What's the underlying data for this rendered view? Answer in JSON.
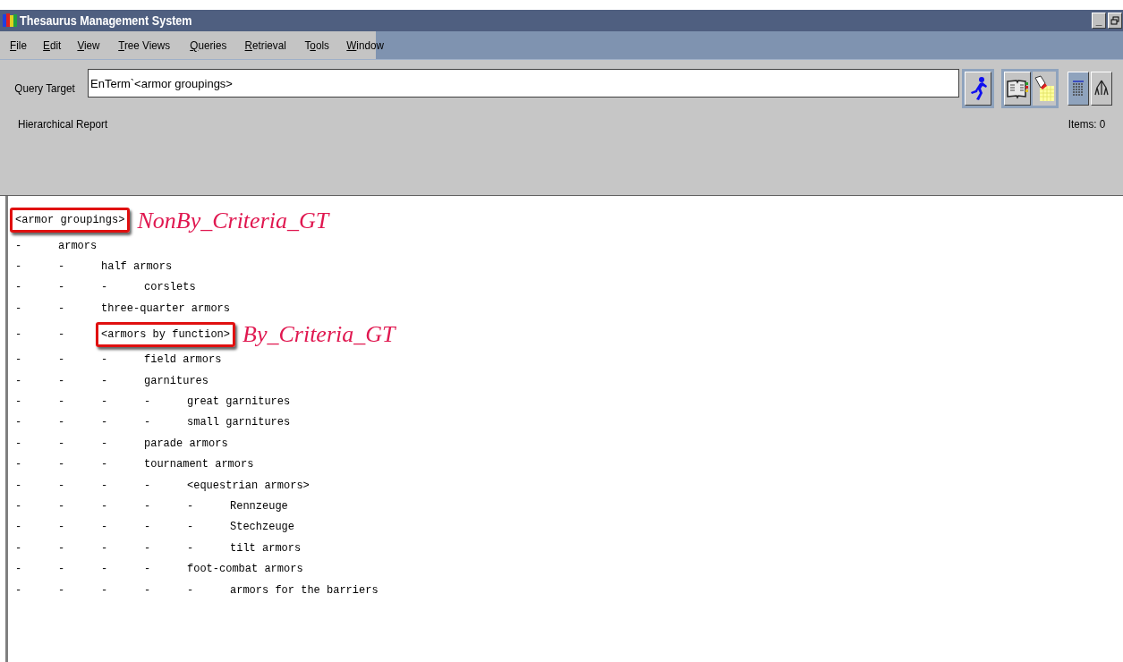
{
  "window": {
    "title": "Thesaurus Management System",
    "controls": [
      "_"
    ]
  },
  "menu": [
    {
      "key": "F",
      "post": "ile"
    },
    {
      "key": "E",
      "post": "dit"
    },
    {
      "key": "V",
      "post": "iew"
    },
    {
      "key": "T",
      "post": "ree Views"
    },
    {
      "key": "Q",
      "post": "ueries"
    },
    {
      "key": "R",
      "post": "etrieval"
    },
    {
      "pre": "T",
      "key": "o",
      "post": "ols"
    },
    {
      "key": "W",
      "post": "indow"
    }
  ],
  "query": {
    "label": "Query Target",
    "value": "EnTerm`<armor groupings>"
  },
  "report": {
    "title": "Hierarchical Report",
    "items": "Items: 0",
    "indent_mark": "-",
    "tree": [
      {
        "text": "<armor groupings>",
        "annotation": "NonBy_Criteria_GT",
        "children": [
          {
            "text": "armors",
            "children": [
              {
                "text": "half armors",
                "children": [
                  {
                    "text": "corslets"
                  }
                ]
              },
              {
                "text": "three-quarter armors"
              },
              {
                "text": "<armors by function>",
                "annotation": "By_Criteria_GT",
                "children": [
                  {
                    "text": "field armors"
                  },
                  {
                    "text": "garnitures",
                    "children": [
                      {
                        "text": "great garnitures"
                      },
                      {
                        "text": "small garnitures"
                      }
                    ]
                  },
                  {
                    "text": "parade armors"
                  },
                  {
                    "text": "tournament armors",
                    "children": [
                      {
                        "text": "<equestrian armors>",
                        "children": [
                          {
                            "text": "Rennzeuge"
                          },
                          {
                            "text": "Stechzeuge"
                          },
                          {
                            "text": "tilt armors"
                          }
                        ]
                      },
                      {
                        "text": "foot-combat armors",
                        "children": [
                          {
                            "text": "armors for the barriers"
                          }
                        ]
                      }
                    ]
                  }
                ]
              }
            ]
          }
        ]
      }
    ]
  }
}
